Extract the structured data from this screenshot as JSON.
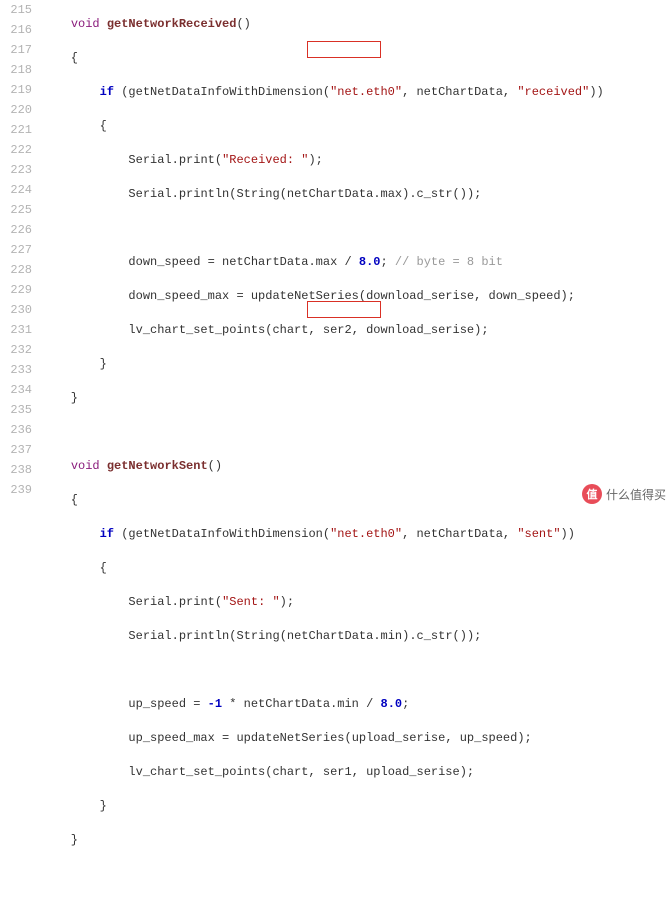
{
  "gutter": {
    "start": 215,
    "end": 239
  },
  "c": {
    "void": "void",
    "if": "if",
    "fn1": "getNetworkReceived",
    "fn2": "getNetworkSent",
    "call": "getNetDataInfoWithDimension",
    "serial": "Serial",
    "print": "print",
    "println": "println",
    "string": "String",
    "cstr": "c_str",
    "netChartData": "netChartData",
    "max": "max",
    "min": "min",
    "down_speed": "down_speed",
    "down_speed_max": "down_speed_max",
    "up_speed": "up_speed",
    "up_speed_max": "up_speed_max",
    "updateNetSeries": "updateNetSeries",
    "download_serise": "download_serise",
    "upload_serise": "upload_serise",
    "lv_chart_set_points": "lv_chart_set_points",
    "chart": "chart",
    "ser1": "ser1",
    "ser2": "ser2",
    "eight": "8.0",
    "neg1": "-1",
    "eth0": "\"net.eth0\"",
    "received": "\"received\"",
    "sent": "\"sent\"",
    "recv_lbl": "\"Received: \"",
    "sent_lbl": "\"Sent: \"",
    "comment": "// byte = 8 bit"
  },
  "watermark": {
    "circle": "值",
    "text": "什么值得买"
  }
}
